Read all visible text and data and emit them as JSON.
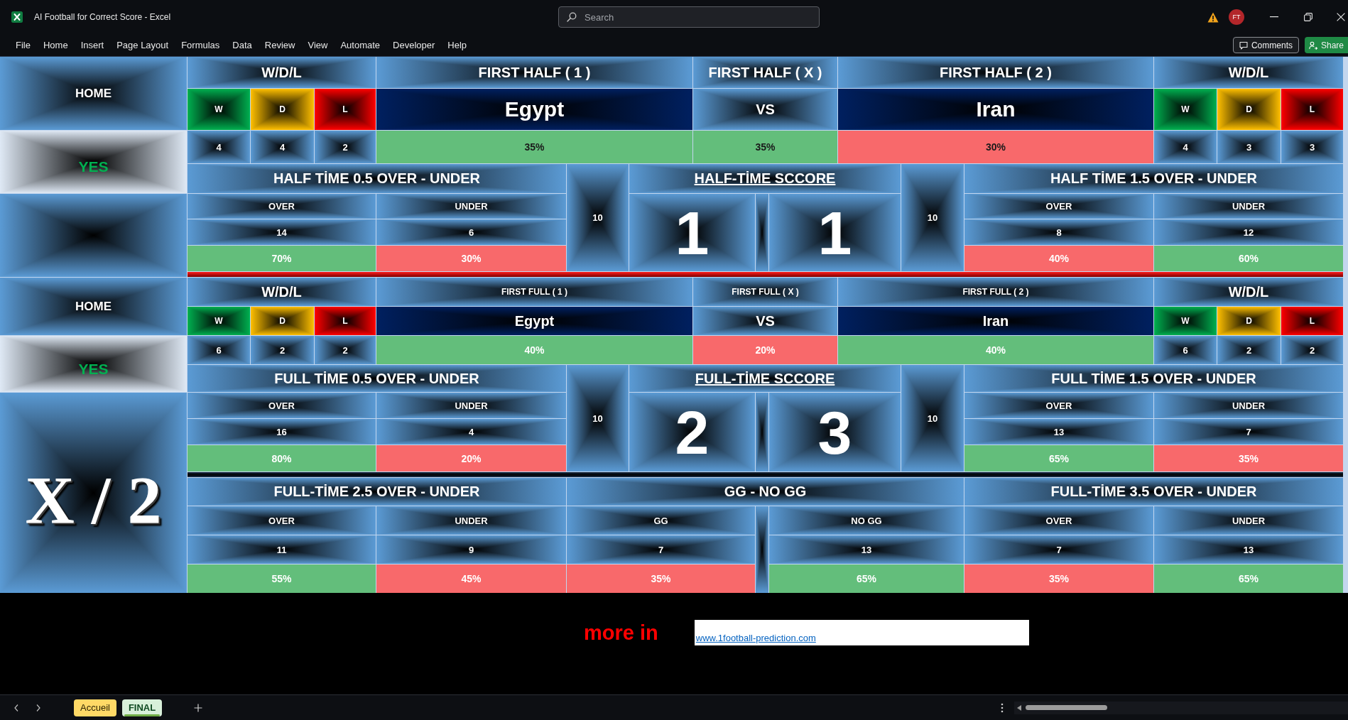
{
  "window": {
    "title": "AI Football for Correct Score - Excel",
    "search_placeholder": "Search",
    "account_initials": "FT"
  },
  "menu": [
    "File",
    "Home",
    "Insert",
    "Page Layout",
    "Formulas",
    "Data",
    "Review",
    "View",
    "Automate",
    "Developer",
    "Help"
  ],
  "ribbon_actions": [
    {
      "kind": "comments",
      "label": "Comments"
    },
    {
      "kind": "share",
      "label": "Share"
    }
  ],
  "sections": [
    {
      "side_label": "HOME",
      "status": "YES",
      "home_form": {
        "title": "W/D/L",
        "results": [
          {
            "kind": "win",
            "label": "W",
            "count": "4"
          },
          {
            "kind": "draw",
            "label": "D",
            "count": "4"
          },
          {
            "kind": "loss",
            "label": "L",
            "count": "2"
          }
        ]
      },
      "outcomes": [
        {
          "kind": "team",
          "title": "FIRST HALF ( 1 )",
          "value": "Egypt",
          "percent": "35%",
          "color": "#63be7b"
        },
        {
          "kind": "versus",
          "title": "FIRST HALF ( X )",
          "value": "VS",
          "percent": "35%",
          "color": "#63be7b"
        },
        {
          "kind": "team",
          "title": "FIRST HALF ( 2 )",
          "value": "Iran",
          "percent": "30%",
          "color": "#f8696b"
        }
      ],
      "away_form": {
        "title": "W/D/L",
        "results": [
          {
            "kind": "win",
            "label": "W",
            "count": "4"
          },
          {
            "kind": "draw",
            "label": "D",
            "count": "3"
          },
          {
            "kind": "loss",
            "label": "L",
            "count": "3"
          }
        ]
      },
      "goals_left": {
        "title": "HALF TİME 0.5 OVER - UNDER",
        "columns": [
          {
            "label": "OVER",
            "count": "14",
            "percent": "70%",
            "color": "#63be7b"
          },
          {
            "label": "UNDER",
            "count": "6",
            "percent": "30%",
            "color": "#f8696b"
          }
        ]
      },
      "left_total": "10",
      "score": {
        "title": "HALF-TİME SCCORE",
        "home": "1",
        "away": "1"
      },
      "right_total": "10",
      "goals_right": {
        "title": "HALF TİME 1.5 OVER - UNDER",
        "columns": [
          {
            "label": "OVER",
            "count": "8",
            "percent": "40%",
            "color": "#f8696b"
          },
          {
            "label": "UNDER",
            "count": "12",
            "percent": "60%",
            "color": "#63be7b"
          }
        ]
      }
    },
    {
      "side_label": "HOME",
      "status": "YES",
      "home_form": {
        "title": "W/D/L",
        "results": [
          {
            "kind": "win",
            "label": "W",
            "count": "6"
          },
          {
            "kind": "draw",
            "label": "D",
            "count": "2"
          },
          {
            "kind": "loss",
            "label": "L",
            "count": "2"
          }
        ]
      },
      "outcomes": [
        {
          "kind": "team",
          "title": "FIRST FULL ( 1 )",
          "value": "Egypt",
          "percent": "40%",
          "color": "#63be7b"
        },
        {
          "kind": "versus",
          "title": "FIRST FULL ( X )",
          "value": "VS",
          "percent": "20%",
          "color": "#f8696b"
        },
        {
          "kind": "team",
          "title": "FIRST FULL ( 2 )",
          "value": "Iran",
          "percent": "40%",
          "color": "#63be7b"
        }
      ],
      "away_form": {
        "title": "W/D/L",
        "results": [
          {
            "kind": "win",
            "label": "W",
            "count": "6"
          },
          {
            "kind": "draw",
            "label": "D",
            "count": "2"
          },
          {
            "kind": "loss",
            "label": "L",
            "count": "2"
          }
        ]
      },
      "goals_left": {
        "title": "FULL TİME 0.5 OVER - UNDER",
        "columns": [
          {
            "label": "OVER",
            "count": "16",
            "percent": "80%",
            "color": "#63be7b"
          },
          {
            "label": "UNDER",
            "count": "4",
            "percent": "20%",
            "color": "#f8696b"
          }
        ]
      },
      "left_total": "10",
      "score": {
        "title": "FULL-TİME SCCORE",
        "home": "2",
        "away": "3"
      },
      "right_total": "10",
      "goals_right": {
        "title": "FULL TİME 1.5 OVER - UNDER",
        "columns": [
          {
            "label": "OVER",
            "count": "13",
            "percent": "65%",
            "color": "#63be7b"
          },
          {
            "label": "UNDER",
            "count": "7",
            "percent": "35%",
            "color": "#f8696b"
          }
        ]
      }
    }
  ],
  "verdict": "X / 2",
  "markets": [
    {
      "title": "FULL-TİME 2.5 OVER - UNDER",
      "columns": [
        {
          "label": "OVER",
          "count": "11",
          "percent": "55%",
          "color": "#63be7b"
        },
        {
          "label": "UNDER",
          "count": "9",
          "percent": "45%",
          "color": "#f8696b"
        }
      ]
    },
    {
      "title": "GG - NO GG",
      "columns": [
        {
          "label": "GG",
          "count": "7",
          "percent": "35%",
          "color": "#f8696b"
        },
        {
          "label": "NO GG",
          "count": "13",
          "percent": "65%",
          "color": "#63be7b"
        }
      ]
    },
    {
      "title": "FULL-TİME 3.5 OVER - UNDER",
      "columns": [
        {
          "label": "OVER",
          "count": "7",
          "percent": "35%",
          "color": "#f8696b"
        },
        {
          "label": "UNDER",
          "count": "13",
          "percent": "65%",
          "color": "#63be7b"
        }
      ]
    }
  ],
  "footer": {
    "label": "more in",
    "link": "www.1football-prediction.com"
  },
  "sheet_tabs": [
    {
      "label": "Accueil",
      "selected": false,
      "color": "#ffd966"
    },
    {
      "label": "FINAL",
      "selected": true,
      "color": "#70ad47"
    }
  ]
}
